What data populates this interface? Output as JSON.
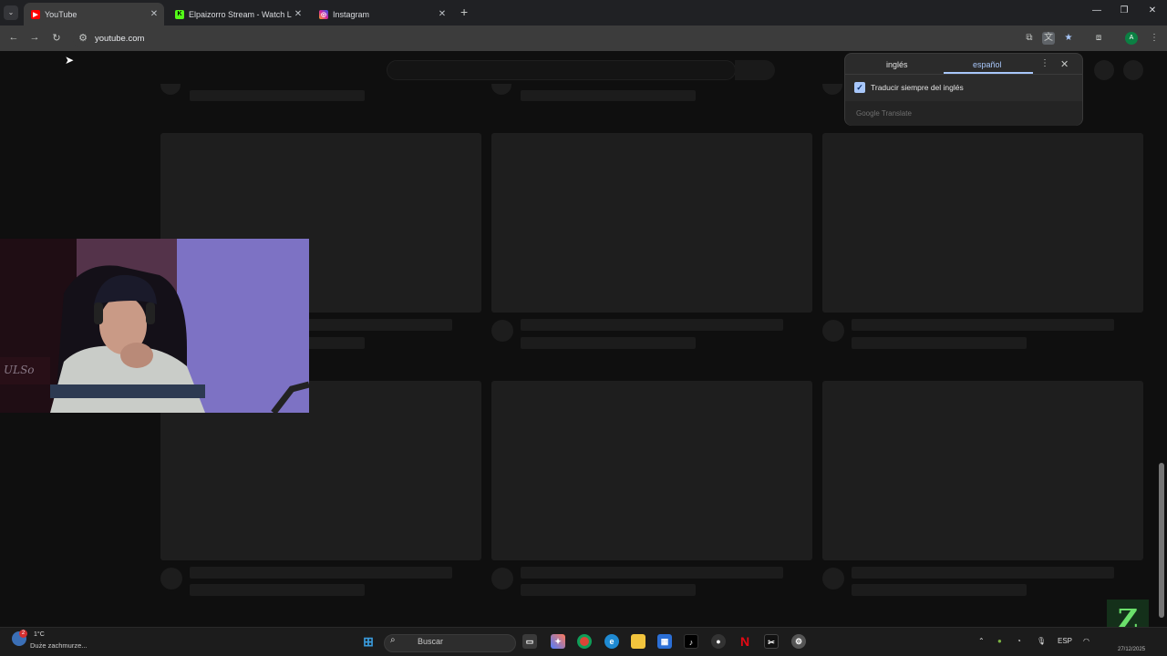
{
  "browser": {
    "tabs": [
      {
        "title": "YouTube",
        "favicon_color": "#ff0000",
        "favicon_glyph": "▶",
        "active": true
      },
      {
        "title": "Elpaizorro Stream - Watch Live",
        "favicon_color": "#53fc18",
        "favicon_glyph": "K",
        "active": false
      },
      {
        "title": "Instagram",
        "favicon_color": "#d6249f",
        "favicon_glyph": "◎",
        "active": false
      }
    ],
    "close_glyph": "✕",
    "new_tab_glyph": "+",
    "tab_menu_glyph": "⌄",
    "window_controls": {
      "minimize": "—",
      "maximize": "❐",
      "close": "✕"
    },
    "url": "youtube.com",
    "profile_initial": "A"
  },
  "translate_popup": {
    "source_language": "inglés",
    "target_language": "español",
    "always_translate_label": "Traducir siempre del inglés",
    "always_translate_checked": true,
    "brand": "Google Translate",
    "menu_glyph": "⋮",
    "close_glyph": "✕"
  },
  "taskbar": {
    "weather_temp": "1°C",
    "weather_desc": "Duże zachmurze...",
    "search_placeholder": "Buscar",
    "tray_language": "ESP",
    "date": "27/12/2025",
    "apps": [
      "windows-start-icon",
      "file-explorer-icon",
      "copilot-icon",
      "chrome-icon",
      "edge-icon",
      "folder-icon",
      "store-icon",
      "tiktok-icon",
      "app-icon",
      "netflix-icon",
      "capcut-icon",
      "settings-icon"
    ]
  },
  "colors": {
    "accent_blue": "#a8c7fa",
    "page_bg": "#0f0f0f",
    "skeleton": "#1e1e1e"
  }
}
